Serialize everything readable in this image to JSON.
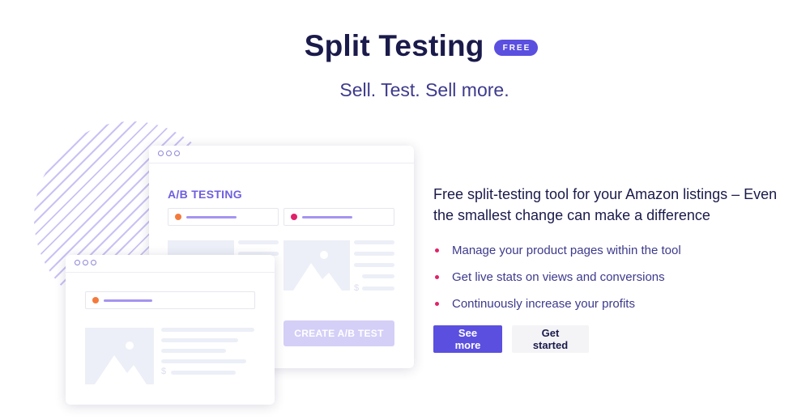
{
  "header": {
    "title": "Split Testing",
    "badge": "FREE",
    "subtitle": "Sell. Test. Sell more."
  },
  "illustration": {
    "back_window": {
      "label": "A/B TESTING",
      "create_button": "CREATE A/B TEST",
      "currency": "$"
    },
    "front_window": {
      "currency": "$"
    },
    "colors": {
      "orange_dot": "#f47a3c",
      "pink_dot": "#e0226b",
      "accent": "#5b4fe0"
    }
  },
  "content": {
    "lead": "Free split-testing tool for your Amazon listings – Even the smallest change can make a difference",
    "features": [
      "Manage your product pages within the tool",
      "Get live stats on views and conversions",
      "Continuously increase your profits"
    ],
    "primary_button": "See more",
    "secondary_button": "Get started"
  }
}
